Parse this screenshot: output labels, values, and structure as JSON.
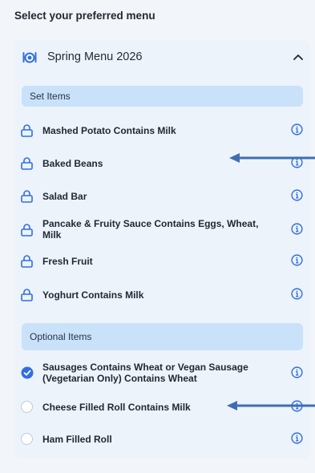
{
  "page": {
    "title": "Select your preferred menu"
  },
  "menu": {
    "name": "Spring Menu 2026",
    "set_section": {
      "label": "Set Items",
      "items": [
        {
          "label": "Mashed Potato Contains Milk"
        },
        {
          "label": "Baked Beans"
        },
        {
          "label": "Salad Bar"
        },
        {
          "label": "Pancake & Fruity Sauce Contains Eggs, Wheat, Milk"
        },
        {
          "label": "Fresh Fruit"
        },
        {
          "label": "Yoghurt Contains Milk"
        }
      ]
    },
    "optional_section": {
      "label": "Optional Items",
      "items": [
        {
          "label": "Sausages Contains Wheat or Vegan Sausage (Vegetarian Only) Contains Wheat",
          "selected": true
        },
        {
          "label": "Cheese Filled Roll Contains Milk",
          "selected": false
        },
        {
          "label": "Ham Filled Roll",
          "selected": false
        }
      ]
    }
  },
  "colors": {
    "accent": "#2f6fe0",
    "section_bg": "#c9e2fa",
    "card_bg": "#edf3fb",
    "annotation_arrow": "#3d6fb0"
  },
  "icons": {
    "menu": "cutlery-plate-icon",
    "locked_item": "lock-icon",
    "info": "info-icon",
    "collapse": "chevron-up-icon",
    "selected": "check-circle-icon",
    "unselected": "empty-radio-icon"
  }
}
